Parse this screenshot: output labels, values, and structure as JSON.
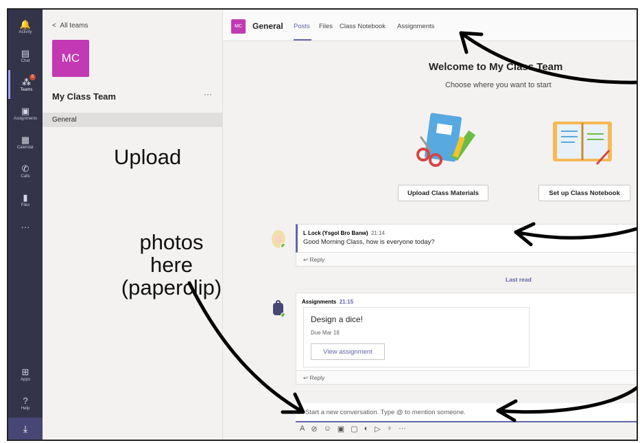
{
  "rail": {
    "items": [
      {
        "label": "Activity",
        "icon": "bell-icon",
        "glyph": "🔔"
      },
      {
        "label": "Chat",
        "icon": "chat-icon",
        "glyph": "▤"
      },
      {
        "label": "Teams",
        "icon": "teams-icon",
        "glyph": "⁂",
        "badge": "0"
      },
      {
        "label": "Assignments",
        "icon": "assignments-icon",
        "glyph": "▣"
      },
      {
        "label": "Calendar",
        "icon": "calendar-icon",
        "glyph": "▦"
      },
      {
        "label": "Calls",
        "icon": "phone-icon",
        "glyph": "✆"
      },
      {
        "label": "Files",
        "icon": "file-icon",
        "glyph": "▮"
      },
      {
        "label": "",
        "icon": "more-icon",
        "glyph": "···"
      },
      {
        "label": "Apps",
        "icon": "apps-icon",
        "glyph": "⊞"
      },
      {
        "label": "Help",
        "icon": "help-icon",
        "glyph": "?"
      }
    ],
    "download_glyph": "⤓"
  },
  "teams": {
    "back_label": "All teams",
    "back_glyph": "<",
    "tile": "MC",
    "name": "My Class Team",
    "more": "···",
    "channel": "General"
  },
  "annotations": {
    "upload": "Upload",
    "photos_line1": "photos",
    "photos_line2": "here",
    "photos_line3": "(paperclip)"
  },
  "header": {
    "tile": "MC",
    "channel": "General",
    "tabs": [
      "Posts",
      "Files",
      "Class Notebook",
      "Assignments"
    ],
    "active_tab": "Posts",
    "accent": "#6264a7",
    "tile_color": "#c239b3"
  },
  "welcome": {
    "title": "Welcome to My Class Team",
    "subtitle": "Choose where you want to start",
    "upload_button": "Upload Class Materials",
    "notebook_button": "Set up Class Notebook"
  },
  "messages": [
    {
      "author": "L Lock (Ysgol Bro Banw)",
      "time": "21:14",
      "text": "Good Morning Class, how is everyone today?",
      "reply": "Reply"
    },
    {
      "author": "Assignments",
      "time": "21:15",
      "card_title": "Design a dice!",
      "due": "Due Mar 18",
      "button": "View assignment",
      "reply": "Reply"
    }
  ],
  "last_read": "Last read",
  "compose": {
    "placeholder": "Start a new conversation. Type @ to mention someone.",
    "tools": [
      {
        "icon": "format-icon",
        "glyph": "A"
      },
      {
        "icon": "paperclip-icon",
        "glyph": "⊘"
      },
      {
        "icon": "emoji-icon",
        "glyph": "☺"
      },
      {
        "icon": "gif-icon",
        "glyph": "▣"
      },
      {
        "icon": "sticker-icon",
        "glyph": "▢"
      },
      {
        "icon": "meet-icon",
        "glyph": "◐"
      },
      {
        "icon": "send-icon",
        "glyph": "▷"
      },
      {
        "icon": "praise-icon",
        "glyph": "♀"
      },
      {
        "icon": "more-icon",
        "glyph": "···"
      }
    ]
  }
}
